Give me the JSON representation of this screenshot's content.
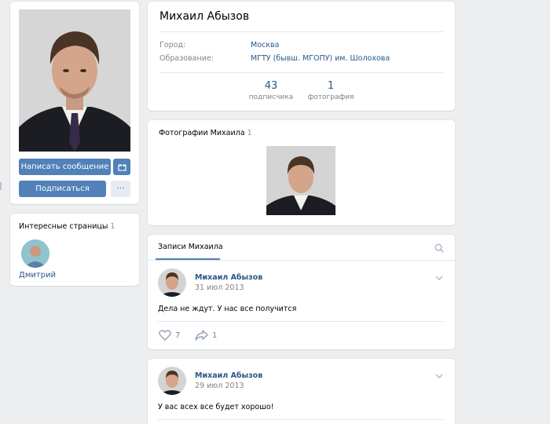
{
  "profile": {
    "name": "Михаил Абызов",
    "info": [
      {
        "label": "Город:",
        "value": "Москва"
      },
      {
        "label": "Образование:",
        "value": "МГТУ (бывш. МГОПУ) им. Шолохова"
      }
    ],
    "counters": [
      {
        "num": "43",
        "label": "подписчика"
      },
      {
        "num": "1",
        "label": "фотография"
      }
    ]
  },
  "actions": {
    "message": "Написать сообщение",
    "subscribe": "Подписаться",
    "more": "···"
  },
  "pages": {
    "title": "Интересные страницы",
    "count": "1",
    "friend": "Дмитрий"
  },
  "photos": {
    "title": "Фотографии Михаила",
    "count": "1"
  },
  "wall": {
    "tab": "Записи Михаила",
    "posts": [
      {
        "author": "Михаил Абызов",
        "date": "31 июл 2013",
        "text": "Дела не ждут. У нас все получится",
        "likes": "7",
        "shares": "1"
      },
      {
        "author": "Михаил Абызов",
        "date": "29 июл 2013",
        "text": "У вас всех все будет хорошо!"
      }
    ]
  },
  "colors": {
    "accent": "#5181b8",
    "link": "#2a5885",
    "background": "#edeef0"
  }
}
